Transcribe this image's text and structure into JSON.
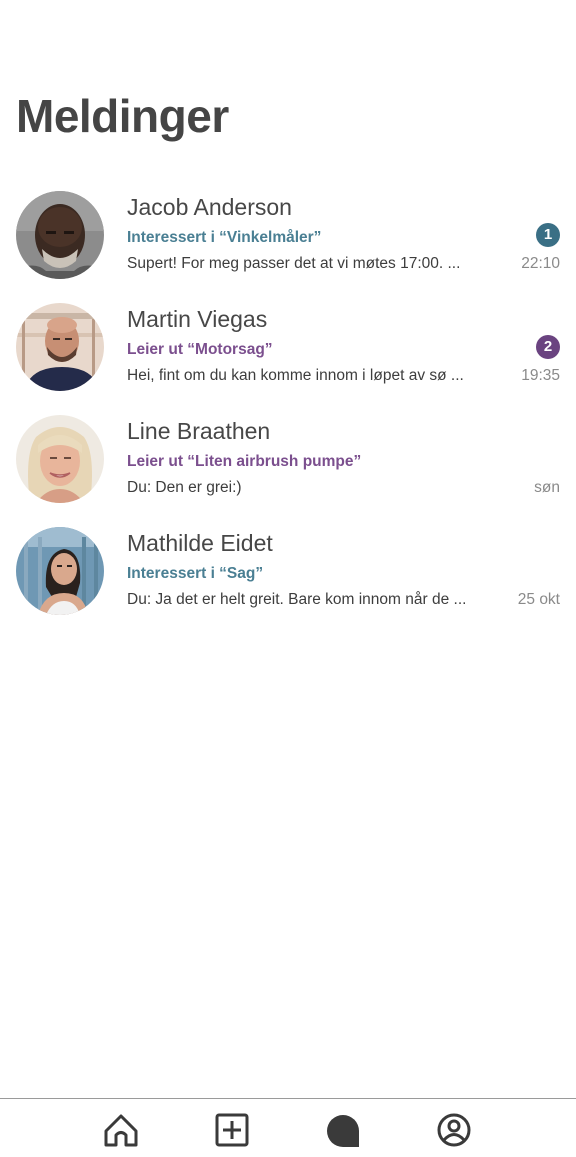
{
  "header": {
    "title": "Meldinger"
  },
  "conversations": [
    {
      "name": "Jacob Anderson",
      "topic": "Interessert i “Vinkelmåler”",
      "topic_kind": "interest",
      "preview": "Supert! For meg passer det at vi møtes 17:00. ...",
      "time": "22:10",
      "unread": "1",
      "badge_color": "#3a6f85"
    },
    {
      "name": "Martin Viegas",
      "topic": "Leier ut “Motorsag”",
      "topic_kind": "rent",
      "preview": "Hei, fint om du kan komme innom i løpet av sø ...",
      "time": "19:35",
      "unread": "2",
      "badge_color": "#6a4380"
    },
    {
      "name": "Line Braathen",
      "topic": "Leier ut “Liten airbrush pumpe”",
      "topic_kind": "rent",
      "preview": "Du: Den er grei:)",
      "time": "søn"
    },
    {
      "name": "Mathilde Eidet",
      "topic": "Interessert i “Sag”",
      "topic_kind": "interest",
      "preview": "Du: Ja det er helt greit. Bare kom innom når de ...",
      "time": "25 okt"
    }
  ],
  "colors": {
    "interest_topic": "#4a7f93",
    "rent_topic": "#7b4f8e",
    "nav_icon": "#3a3a3a"
  },
  "bottom_nav": {
    "items": [
      {
        "icon": "home-icon"
      },
      {
        "icon": "add-square-icon"
      },
      {
        "icon": "chat-bubble-icon",
        "active": true
      },
      {
        "icon": "profile-icon"
      }
    ]
  }
}
